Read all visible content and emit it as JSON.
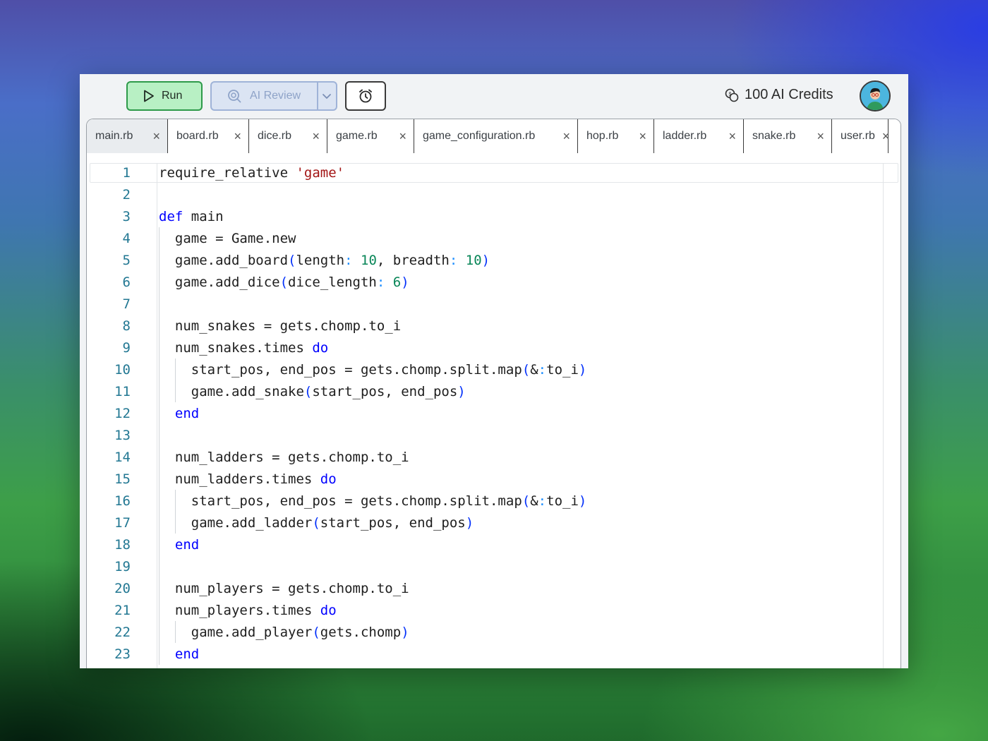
{
  "toolbar": {
    "run_label": "Run",
    "ai_review_label": "AI Review",
    "credits_label": "100 AI Credits"
  },
  "tabs": [
    {
      "label": "main.rb",
      "active": true
    },
    {
      "label": "board.rb"
    },
    {
      "label": "dice.rb"
    },
    {
      "label": "game.rb"
    },
    {
      "label": "game_configuration.rb"
    },
    {
      "label": "hop.rb"
    },
    {
      "label": "ladder.rb"
    },
    {
      "label": "snake.rb"
    },
    {
      "label": "user.rb"
    }
  ],
  "editor": {
    "language": "ruby",
    "lines": [
      "require_relative 'game'",
      "",
      "def main",
      "  game = Game.new",
      "  game.add_board(length: 10, breadth: 10)",
      "  game.add_dice(dice_length: 6)",
      "",
      "  num_snakes = gets.chomp.to_i",
      "  num_snakes.times do",
      "    start_pos, end_pos = gets.chomp.split.map(&:to_i)",
      "    game.add_snake(start_pos, end_pos)",
      "  end",
      "",
      "  num_ladders = gets.chomp.to_i",
      "  num_ladders.times do",
      "    start_pos, end_pos = gets.chomp.split.map(&:to_i)",
      "    game.add_ladder(start_pos, end_pos)",
      "  end",
      "",
      "  num_players = gets.chomp.to_i",
      "  num_players.times do",
      "    game.add_player(gets.chomp)",
      "  end"
    ]
  },
  "colors": {
    "keyword": "#0000ff",
    "string": "#a31515",
    "number": "#098658",
    "line_number": "#237893",
    "run_bg": "#b8f0c4",
    "run_border": "#2e9a4a"
  }
}
